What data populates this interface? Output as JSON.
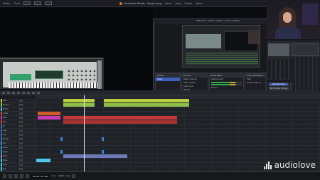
{
  "daw": {
    "menu": [
      "Studio",
      "Cloud"
    ],
    "song_title": "Orchestral Studio - Song1.song",
    "top_items": [
      "Home",
      "Song",
      "Project",
      "Show"
    ]
  },
  "obs": {
    "title": "OBS 29.1.3 - Profile: Untitled - Scenes: Untitled",
    "docks": {
      "scenes": {
        "title": "Scenes",
        "items": [
          "Scene"
        ]
      },
      "sources": {
        "title": "Sources",
        "items": [
          "Display Capture",
          "Video Capture",
          "Audio Input",
          "Window",
          "Image",
          "Text"
        ]
      },
      "mixer": {
        "title": "Audio Mixer",
        "items": [
          "Desktop Audio",
          "Mic/Aux"
        ]
      },
      "transitions": {
        "title": "Scene Transitions",
        "items": [
          "Fade",
          "Duration 300 ms"
        ]
      },
      "controls": {
        "title": "Controls",
        "items": [
          "Start Streaming",
          "Stop Recording",
          "Start Virtual Camera",
          "Studio Mode",
          "Settings",
          "Exit"
        ]
      }
    },
    "status": "LIVE 00:00:00  REC 00:12:43  CPU 7.5%"
  },
  "arrange": {
    "tracks": [
      {
        "name": "Main",
        "color": "#e2c33b"
      },
      {
        "name": "Synth 1",
        "color": "#8bd13b"
      },
      {
        "name": "Drums",
        "color": "#4ec7e8"
      },
      {
        "name": "Vocals",
        "color": "#d35b2a"
      },
      {
        "name": "Bass",
        "color": "#c93ab2"
      },
      {
        "name": "Pad",
        "color": "#d43c3c"
      },
      {
        "name": "FX",
        "color": "#3c6fd4"
      },
      {
        "name": "Lead",
        "color": "#3c6fd4"
      },
      {
        "name": "Keys",
        "color": "#3c6fd4"
      },
      {
        "name": "Strings",
        "color": "#3c6fd4"
      },
      {
        "name": "Perc",
        "color": "#2fa3d9"
      },
      {
        "name": "Guitar",
        "color": "#2fa3d9"
      },
      {
        "name": "Organ",
        "color": "#2fa3d9"
      },
      {
        "name": "Choir",
        "color": "#9b8ad4"
      },
      {
        "name": "Brass",
        "color": "#4ec7e8"
      },
      {
        "name": "Piano",
        "color": "#4ec7e8"
      },
      {
        "name": "Sub",
        "color": "#4ec7e8"
      }
    ],
    "transport": {
      "position": "00:00:26.582",
      "tempo": "120.00",
      "signature": "4 / 4",
      "key": "Key"
    }
  },
  "watermark": {
    "text": "audiolove"
  }
}
